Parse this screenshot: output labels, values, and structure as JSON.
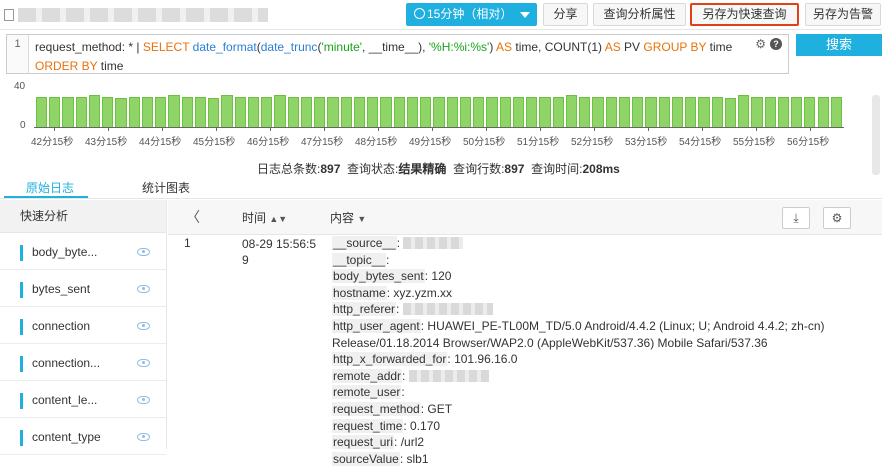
{
  "header": {
    "time_range": "15分钟（相对）",
    "share": "分享",
    "query_props": "查询分析属性",
    "save_quick_query": "另存为快速查询",
    "save_alert": "另存为告警"
  },
  "query": {
    "line_number": "1",
    "tokens": {
      "p1": "request_method: * | ",
      "select": "SELECT ",
      "fn_date_format": "date_format",
      "p2": "(",
      "fn_date_trunc": "date_trunc",
      "p3": "(",
      "s_minute": "'minute'",
      "p4": ", __time__), ",
      "s_fmt": "'%H:%i:%s'",
      "p5": ") ",
      "as1": "AS",
      "p6": " time, COUNT(1) ",
      "as2": "AS",
      "p7": " PV ",
      "group": "GROUP BY",
      "p8": " time",
      "order": "ORDER BY",
      "p9": " time"
    },
    "search_button": "搜索"
  },
  "chart_data": {
    "type": "bar",
    "categories": [
      "42分15秒",
      "43分15秒",
      "44分15秒",
      "45分15秒",
      "46分15秒",
      "47分15秒",
      "48分15秒",
      "49分15秒",
      "50分15秒",
      "51分15秒",
      "52分15秒",
      "53分15秒",
      "54分15秒",
      "55分15秒",
      "56分15秒"
    ],
    "values": [
      30,
      30,
      30,
      30,
      31,
      30,
      29,
      30,
      30,
      30,
      31,
      30,
      30,
      29,
      31,
      30,
      30,
      30,
      31,
      30,
      30,
      30,
      30,
      30,
      30,
      30,
      30,
      30,
      30,
      30,
      30,
      30,
      30,
      30,
      30,
      30,
      30,
      30,
      30,
      30,
      31,
      30,
      30,
      30,
      30,
      30,
      30,
      30,
      30,
      30,
      30,
      30,
      29,
      31,
      30,
      30,
      30,
      30,
      30,
      30,
      30
    ],
    "yticks": [
      "40",
      "0"
    ],
    "ylim": [
      0,
      40
    ]
  },
  "stats": {
    "total_label": "日志总条数:",
    "total_value": "897",
    "status_label": "查询状态:",
    "status_value": "结果精确",
    "rows_label": "查询行数:",
    "rows_value": "897",
    "time_label": "查询时间:",
    "time_value": "208ms"
  },
  "tabs": {
    "raw": "原始日志",
    "chart": "统计图表"
  },
  "quick_analysis": {
    "title": "快速分析",
    "items": [
      {
        "label": "body_byte..."
      },
      {
        "label": "bytes_sent"
      },
      {
        "label": "connection"
      },
      {
        "label": "connection..."
      },
      {
        "label": "content_le..."
      },
      {
        "label": "content_type"
      }
    ]
  },
  "log_table": {
    "prev": "〈",
    "col_time": "时间",
    "col_content": "内容",
    "row_number": "1",
    "row_time": "08-29 15:56:59",
    "fields": [
      {
        "k": "__source__",
        "v": "",
        "blur": 60
      },
      {
        "k": "__topic__",
        "v": "",
        "blur": 0
      },
      {
        "k": "body_bytes_sent",
        "v": "120",
        "blur": 0
      },
      {
        "k": "hostname",
        "v": "xyz.yzm.xx",
        "blur": 0
      },
      {
        "k": "http_referer",
        "v": "",
        "blur": 90
      },
      {
        "k": "http_user_agent",
        "v": "HUAWEI_PE-TL00M_TD/5.0 Android/4.4.2 (Linux; U; Android 4.4.2; zh-cn) Release/01.18.2014 Browser/WAP2.0 (AppleWebKit/537.36) Mobile Safari/537.36",
        "blur": 0
      },
      {
        "k": "http_x_forwarded_for",
        "v": "101.96.16.0",
        "blur": 0
      },
      {
        "k": "remote_addr",
        "v": "",
        "blur": 80
      },
      {
        "k": "remote_user",
        "v": "",
        "blur": 0
      },
      {
        "k": "request_method",
        "v": "GET",
        "blur": 0
      },
      {
        "k": "request_time",
        "v": "0.170",
        "blur": 0
      },
      {
        "k": "request_uri",
        "v": "/url2",
        "blur": 0
      },
      {
        "k": "sourceValue",
        "v": "slb1",
        "blur": 0
      }
    ]
  }
}
